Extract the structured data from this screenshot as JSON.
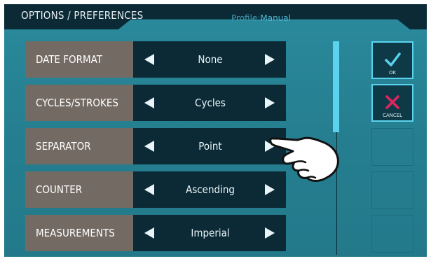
{
  "header": {
    "title": "OPTIONS / PREFERENCES",
    "profile_label": "Profile:",
    "profile_value": "Manual"
  },
  "options": [
    {
      "label": "DATE FORMAT",
      "value": "None"
    },
    {
      "label": "CYCLES/STROKES",
      "value": "Cycles"
    },
    {
      "label": "SEPARATOR",
      "value": "Point"
    },
    {
      "label": "COUNTER",
      "value": "Ascending"
    },
    {
      "label": "MEASUREMENTS",
      "value": "Imperial"
    }
  ],
  "actions": {
    "ok_label": "OK",
    "cancel_label": "CANCEL"
  },
  "colors": {
    "accent": "#5bd2ee",
    "cancel": "#e0245e",
    "background": "#2a8a9c",
    "control": "#0c2a36",
    "label_bg": "#736a63"
  }
}
